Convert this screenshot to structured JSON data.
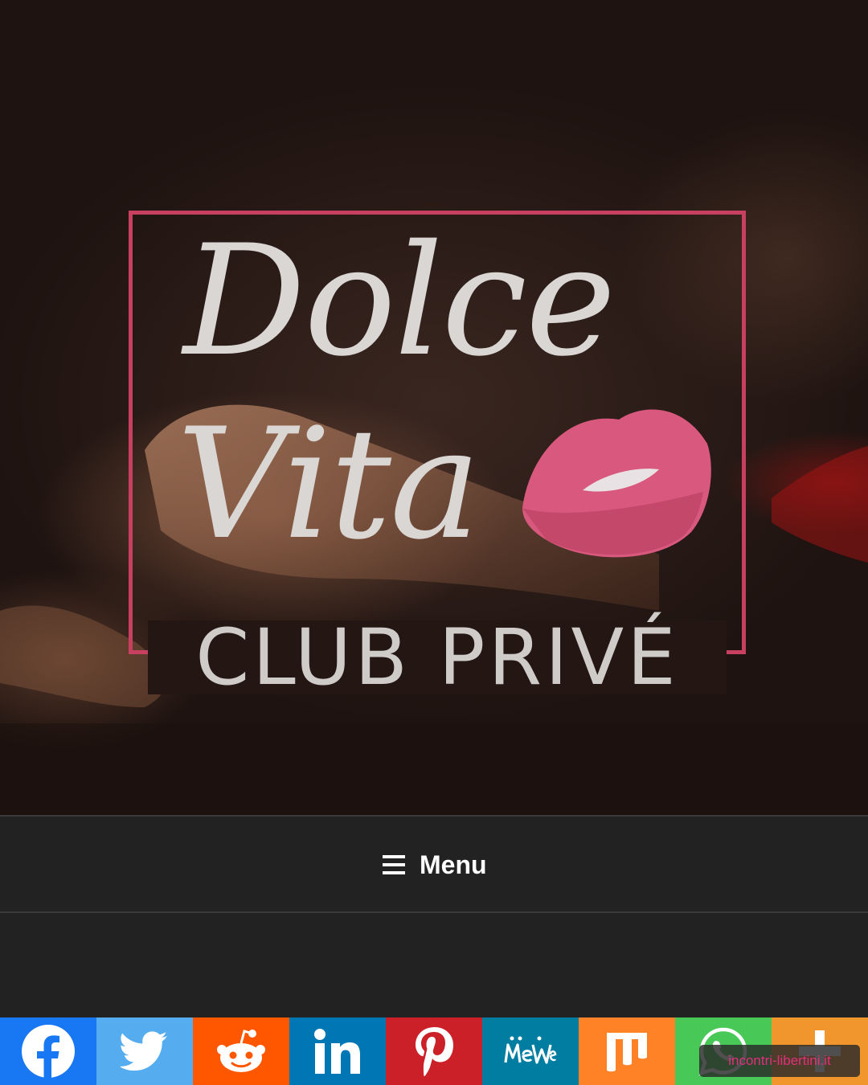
{
  "header": {
    "logo": {
      "script_line1": "Dolce",
      "script_line2": "Vita",
      "subtitle": "CLUB PRIVÉ",
      "frame_color": "#c8405f",
      "text_color": "#d9d6d4",
      "lips_color": "#d9587e"
    }
  },
  "nav": {
    "menu_icon": "hamburger-icon",
    "menu_label": "Menu"
  },
  "share_bar": {
    "buttons": [
      {
        "name": "facebook",
        "icon": "facebook-icon",
        "color": "#1877f2"
      },
      {
        "name": "twitter",
        "icon": "twitter-icon",
        "color": "#55acee"
      },
      {
        "name": "reddit",
        "icon": "reddit-icon",
        "color": "#ff5700"
      },
      {
        "name": "linkedin",
        "icon": "linkedin-icon",
        "color": "#0077b5"
      },
      {
        "name": "pinterest",
        "icon": "pinterest-icon",
        "color": "#cb2027"
      },
      {
        "name": "mewe",
        "icon": "mewe-icon",
        "color": "#007da1"
      },
      {
        "name": "mix",
        "icon": "mix-icon",
        "color": "#ff8226"
      },
      {
        "name": "whatsapp",
        "icon": "whatsapp-icon",
        "color": "#48c857"
      },
      {
        "name": "more",
        "icon": "plus-icon",
        "color": "#f1962d"
      }
    ]
  },
  "watermark": {
    "text": "incontri-libertini.it"
  }
}
